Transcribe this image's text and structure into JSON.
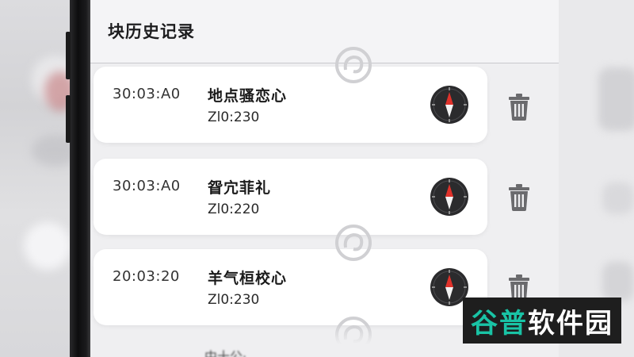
{
  "page_title": "块历史记录",
  "records": [
    {
      "time": "30:03:A0",
      "name": "地点骚恋心",
      "value": "Zl0:230"
    },
    {
      "time": "30:03:A0",
      "name": "眢宂菲礼",
      "value": "Zl0:220"
    },
    {
      "time": "20:03:20",
      "name": "羊气桓校心",
      "value": "Zl0:230"
    }
  ],
  "partial_row_text": "中十公·",
  "icons": {
    "compass": "compass-icon",
    "delete": "trash-icon",
    "overlay": "ghost-logo-icon"
  },
  "watermark": {
    "part1": "谷普",
    "part2": "软件园",
    "color1": "#19c3a5",
    "color2": "#ffffff"
  },
  "colors": {
    "compass_needle": "#e0322b",
    "compass_body": "#2b2b2d",
    "trash": "#6a6a6d"
  }
}
